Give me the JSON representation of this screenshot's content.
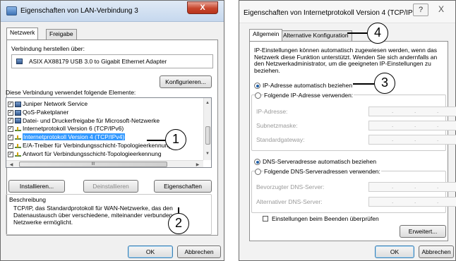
{
  "window_left": {
    "title": "Eigenschaften von LAN-Verbindung 3",
    "close_glyph": "X",
    "tabs": [
      "Netzwerk",
      "Freigabe"
    ],
    "connect_label": "Verbindung herstellen über:",
    "adapter_name": "ASIX AX88179 USB 3.0 to Gigabit Ethernet Adapter",
    "configure_button": "Konfigurieren...",
    "elements_label": "Diese Verbindung verwendet folgende Elemente:",
    "items": [
      {
        "label": "Juniper Network Service",
        "icon": "network-service-icon"
      },
      {
        "label": "QoS-Paketplaner",
        "icon": "network-service-icon"
      },
      {
        "label": "Datei- und Druckerfreigabe für Microsoft-Netzwerke",
        "icon": "network-service-icon"
      },
      {
        "label": "Internetprotokoll Version 6 (TCP/IPv6)",
        "icon": "protocol-icon"
      },
      {
        "label": "Internetprotokoll Version 4 (TCP/IPv4)",
        "icon": "protocol-icon"
      },
      {
        "label": "E/A-Treiber für Verbindungsschicht-Topologieerkennungszu",
        "icon": "protocol-icon"
      },
      {
        "label": "Antwort für Verbindungsschicht-Topologieerkennung",
        "icon": "protocol-icon"
      }
    ],
    "selected_index": 4,
    "hscroll_thumb_label": "III",
    "install_button": "Installieren...",
    "uninstall_button": "Deinstallieren",
    "properties_button": "Eigenschaften",
    "description_title": "Beschreibung",
    "description_text": "TCP/IP, das Standardprotokoll für WAN-Netzwerke, das den Datenaustausch über verschiedene, miteinander verbundene Netzwerke ermöglicht.",
    "ok_button": "OK",
    "cancel_button": "Abbrechen"
  },
  "window_right": {
    "title": "Eigenschaften von Internetprotokoll Version 4 (TCP/IPv...",
    "help_glyph": "?",
    "close_glyph": "X",
    "tabs": [
      "Allgemein",
      "Alternative Konfiguration"
    ],
    "intro_text": "IP-Einstellungen können automatisch zugewiesen werden, wenn das Netzwerk diese Funktion unterstützt. Wenden Sie sich andernfalls an den Netzwerkadministrator, um die geeigneten IP-Einstellungen zu beziehen.",
    "radio_auto_ip": "IP-Adresse automatisch beziehen",
    "radio_manual_ip": "Folgende IP-Adresse verwenden:",
    "ip_label": "IP-Adresse:",
    "subnet_label": "Subnetzmaske:",
    "gateway_label": "Standardgateway:",
    "radio_auto_dns": "DNS-Serveradresse automatisch beziehen",
    "radio_manual_dns": "Folgende DNS-Serveradressen verwenden:",
    "preferred_dns_label": "Bevorzugter DNS-Server:",
    "alternate_dns_label": "Alternativer DNS-Server:",
    "validate_checkbox": "Einstellungen beim Beenden überprüfen",
    "advanced_button": "Erweitert...",
    "ok_button": "OK",
    "cancel_button": "Abbrechen",
    "ip_dot": "."
  },
  "callouts": [
    "1",
    "2",
    "3",
    "4"
  ]
}
